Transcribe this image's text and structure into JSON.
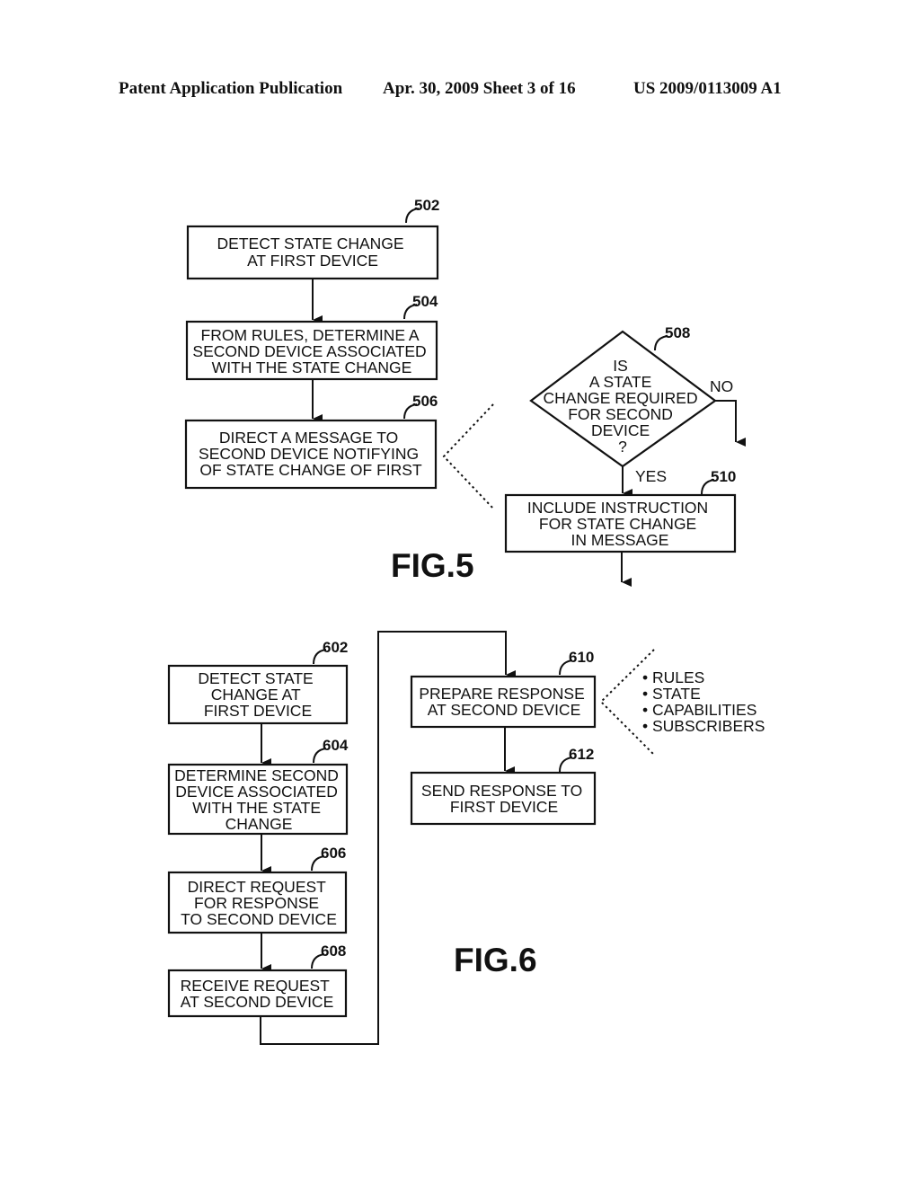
{
  "header": {
    "left": "Patent Application Publication",
    "middle": "Apr. 30, 2009  Sheet 3 of 16",
    "right": "US 2009/0113009 A1"
  },
  "fig5": {
    "title": "FIG.5",
    "steps": [
      {
        "ref": "502",
        "lines": [
          "DETECT STATE CHANGE",
          "AT FIRST DEVICE"
        ]
      },
      {
        "ref": "504",
        "lines": [
          "FROM RULES, DETERMINE A",
          "SECOND DEVICE ASSOCIATED",
          "WITH THE STATE CHANGE"
        ]
      },
      {
        "ref": "506",
        "lines": [
          "DIRECT A MESSAGE TO",
          "SECOND DEVICE NOTIFYING",
          "OF STATE CHANGE OF FIRST"
        ]
      }
    ],
    "decision": {
      "ref": "508",
      "lines": [
        "IS",
        "A STATE",
        "CHANGE REQUIRED",
        "FOR SECOND",
        "DEVICE",
        "?"
      ],
      "yes_label": "YES",
      "no_label": "NO"
    },
    "instruction": {
      "ref": "510",
      "lines": [
        "INCLUDE INSTRUCTION",
        "FOR STATE CHANGE",
        "IN MESSAGE"
      ]
    }
  },
  "fig6": {
    "title": "FIG.6",
    "steps": [
      {
        "ref": "602",
        "lines": [
          "DETECT STATE",
          "CHANGE AT",
          "FIRST DEVICE"
        ]
      },
      {
        "ref": "604",
        "lines": [
          "DETERMINE SECOND",
          "DEVICE ASSOCIATED",
          "WITH THE STATE",
          "CHANGE"
        ]
      },
      {
        "ref": "606",
        "lines": [
          "DIRECT REQUEST",
          "FOR RESPONSE",
          "TO SECOND DEVICE"
        ]
      },
      {
        "ref": "608",
        "lines": [
          "RECEIVE REQUEST",
          "AT SECOND DEVICE"
        ]
      },
      {
        "ref": "610",
        "lines": [
          "PREPARE RESPONSE",
          "AT SECOND DEVICE"
        ]
      },
      {
        "ref": "612",
        "lines": [
          "SEND RESPONSE TO",
          "FIRST DEVICE"
        ]
      }
    ],
    "factors": [
      "• RULES",
      "• STATE",
      "• CAPABILITIES",
      "• SUBSCRIBERS"
    ]
  }
}
